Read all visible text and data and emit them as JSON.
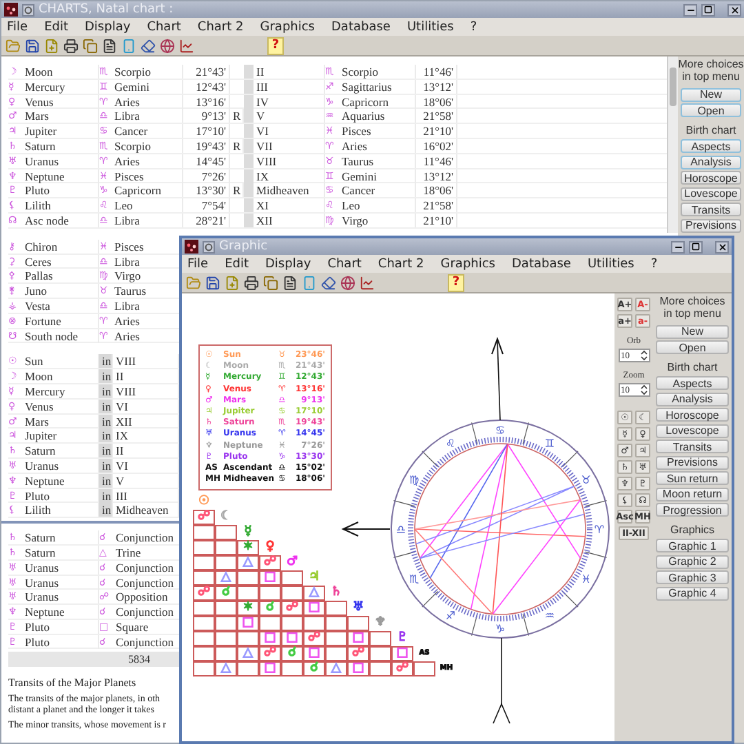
{
  "back_window": {
    "title": "CHARTS, Natal chart :",
    "menu": [
      "File",
      "Edit",
      "Display",
      "Chart",
      "Chart 2",
      "Graphics",
      "Database",
      "Utilities",
      "?"
    ],
    "help": "?",
    "positions": [
      {
        "glyph": "☽",
        "name": "Moon",
        "sign_glyph": "♏",
        "sign": "Scorpio",
        "degree": "21°43'",
        "house": "II",
        "house_sign_glyph": "♏",
        "house_sign": "Scorpio",
        "house_degree": "11°46'"
      },
      {
        "glyph": "☿",
        "name": "Mercury",
        "sign_glyph": "♊",
        "sign": "Gemini",
        "degree": "12°43'",
        "house": "III",
        "house_sign_glyph": "♐",
        "house_sign": "Sagittarius",
        "house_degree": "13°12'"
      },
      {
        "glyph": "♀",
        "name": "Venus",
        "sign_glyph": "♈",
        "sign": "Aries",
        "degree": "13°16'",
        "house": "IV",
        "house_sign_glyph": "♑",
        "house_sign": "Capricorn",
        "house_degree": "18°06'"
      },
      {
        "glyph": "♂",
        "name": "Mars",
        "sign_glyph": "♎",
        "sign": "Libra",
        "degree": "9°13'",
        "retro": "R",
        "house": "V",
        "house_sign_glyph": "♒",
        "house_sign": "Aquarius",
        "house_degree": "21°58'"
      },
      {
        "glyph": "♃",
        "name": "Jupiter",
        "sign_glyph": "♋",
        "sign": "Cancer",
        "degree": "17°10'",
        "house": "VI",
        "house_sign_glyph": "♓",
        "house_sign": "Pisces",
        "house_degree": "21°10'"
      },
      {
        "glyph": "♄",
        "name": "Saturn",
        "sign_glyph": "♏",
        "sign": "Scorpio",
        "degree": "19°43'",
        "retro": "R",
        "house": "VII",
        "house_sign_glyph": "♈",
        "house_sign": "Aries",
        "house_degree": "16°02'"
      },
      {
        "glyph": "♅",
        "name": "Uranus",
        "sign_glyph": "♈",
        "sign": "Aries",
        "degree": "14°45'",
        "house": "VIII",
        "house_sign_glyph": "♉",
        "house_sign": "Taurus",
        "house_degree": "11°46'"
      },
      {
        "glyph": "♆",
        "name": "Neptune",
        "sign_glyph": "♓",
        "sign": "Pisces",
        "degree": "7°26'",
        "house": "IX",
        "house_sign_glyph": "♊",
        "house_sign": "Gemini",
        "house_degree": "13°12'"
      },
      {
        "glyph": "♇",
        "name": "Pluto",
        "sign_glyph": "♑",
        "sign": "Capricorn",
        "degree": "13°30'",
        "retro": "R",
        "house": "Midheaven",
        "house_sign_glyph": "♋",
        "house_sign": "Cancer",
        "house_degree": "18°06'"
      },
      {
        "glyph": "⚸",
        "name": "Lilith",
        "sign_glyph": "♌",
        "sign": "Leo",
        "degree": "7°54'",
        "house": "XI",
        "house_sign_glyph": "♌",
        "house_sign": "Leo",
        "house_degree": "21°58'"
      },
      {
        "glyph": "☊",
        "name": "Asc node",
        "sign_glyph": "♎",
        "sign": "Libra",
        "degree": "28°21'",
        "house": "XII",
        "house_sign_glyph": "♍",
        "house_sign": "Virgo",
        "house_degree": "21°10'"
      }
    ],
    "points": [
      {
        "glyph": "⚷",
        "name": "Chiron",
        "sign_glyph": "♓",
        "sign": "Pisces"
      },
      {
        "glyph": "⚳",
        "name": "Ceres",
        "sign_glyph": "♎",
        "sign": "Libra"
      },
      {
        "glyph": "⚴",
        "name": "Pallas",
        "sign_glyph": "♍",
        "sign": "Virgo"
      },
      {
        "glyph": "⚵",
        "name": "Juno",
        "sign_glyph": "♉",
        "sign": "Taurus"
      },
      {
        "glyph": "⚶",
        "name": "Vesta",
        "sign_glyph": "♎",
        "sign": "Libra"
      },
      {
        "glyph": "⊗",
        "name": "Fortune",
        "sign_glyph": "♈",
        "sign": "Aries"
      },
      {
        "glyph": "☋",
        "name": "South node",
        "sign_glyph": "♈",
        "sign": "Aries"
      }
    ],
    "houses": [
      {
        "glyph": "☉",
        "name": "Sun",
        "prep": "in",
        "house": "VIII"
      },
      {
        "glyph": "☽",
        "name": "Moon",
        "prep": "in",
        "house": "II"
      },
      {
        "glyph": "☿",
        "name": "Mercury",
        "prep": "in",
        "house": "VIII"
      },
      {
        "glyph": "♀",
        "name": "Venus",
        "prep": "in",
        "house": "VI"
      },
      {
        "glyph": "♂",
        "name": "Mars",
        "prep": "in",
        "house": "XII"
      },
      {
        "glyph": "♃",
        "name": "Jupiter",
        "prep": "in",
        "house": "IX"
      },
      {
        "glyph": "♄",
        "name": "Saturn",
        "prep": "in",
        "house": "II"
      },
      {
        "glyph": "♅",
        "name": "Uranus",
        "prep": "in",
        "house": "VI"
      },
      {
        "glyph": "♆",
        "name": "Neptune",
        "prep": "in",
        "house": "V"
      },
      {
        "glyph": "♇",
        "name": "Pluto",
        "prep": "in",
        "house": "III"
      },
      {
        "glyph": "⚸",
        "name": "Lilith",
        "prep": "in",
        "house": "Midheaven"
      }
    ],
    "aspects": [
      {
        "glyph": "♄",
        "name": "Saturn",
        "aspect_glyph": "☌",
        "aspect": "Conjunction"
      },
      {
        "glyph": "♄",
        "name": "Saturn",
        "aspect_glyph": "△",
        "aspect": "Trine"
      },
      {
        "glyph": "♅",
        "name": "Uranus",
        "aspect_glyph": "☌",
        "aspect": "Conjunction"
      },
      {
        "glyph": "♅",
        "name": "Uranus",
        "aspect_glyph": "☌",
        "aspect": "Conjunction"
      },
      {
        "glyph": "♅",
        "name": "Uranus",
        "aspect_glyph": "☍",
        "aspect": "Opposition"
      },
      {
        "glyph": "♆",
        "name": "Neptune",
        "aspect_glyph": "☌",
        "aspect": "Conjunction"
      },
      {
        "glyph": "♇",
        "name": "Pluto",
        "aspect_glyph": "□",
        "aspect": "Square"
      },
      {
        "glyph": "♇",
        "name": "Pluto",
        "aspect_glyph": "☌",
        "aspect": "Conjunction"
      }
    ],
    "total": "5834",
    "article": {
      "title": "Transits of the Major Planets",
      "paragraphs": [
        [
          "The transits of the major planets, in oth",
          "distant a planet and the longer it takes"
        ],
        [
          "The minor transits, whose movement is r"
        ]
      ]
    },
    "panel": {
      "note": "More choices in top menu",
      "buttons": [
        {
          "label": "New",
          "highlighted": true
        },
        {
          "label": "Open",
          "highlighted": true
        }
      ],
      "heading": "Birth chart",
      "chart_buttons": [
        {
          "label": "Aspects",
          "highlighted": true
        },
        {
          "label": "Analysis",
          "highlighted": true
        },
        {
          "label": "Horoscope",
          "highlighted": false
        },
        {
          "label": "Lovescope",
          "highlighted": false
        },
        {
          "label": "Transits",
          "highlighted": false
        },
        {
          "label": "Previsions",
          "highlighted": false
        }
      ]
    }
  },
  "graphic_window": {
    "title": "Graphic",
    "menu": [
      "File",
      "Edit",
      "Display",
      "Chart",
      "Chart 2",
      "Graphics",
      "Database",
      "Utilities",
      "?"
    ],
    "help": "?",
    "legend": [
      {
        "glyph": "☉",
        "name": "Sun",
        "sign_glyph": "♉",
        "degree": "23°46'",
        "color": "#ff9955"
      },
      {
        "glyph": "☾",
        "name": "Moon",
        "sign_glyph": "♏",
        "degree": "21°43'",
        "color": "#aaaaaa"
      },
      {
        "glyph": "☿",
        "name": "Mercury",
        "sign_glyph": "♊",
        "degree": "12°43'",
        "color": "#33aa33"
      },
      {
        "glyph": "♀",
        "name": "Venus",
        "sign_glyph": "♈",
        "degree": "13°16'",
        "color": "#ff3333"
      },
      {
        "glyph": "♂",
        "name": "Mars",
        "sign_glyph": "♎",
        "degree": "9°13'",
        "color": "#ee33ee"
      },
      {
        "glyph": "♃",
        "name": "Jupiter",
        "sign_glyph": "♋",
        "degree": "17°10'",
        "color": "#99cc33"
      },
      {
        "glyph": "♄",
        "name": "Saturn",
        "sign_glyph": "♏",
        "degree": "19°43'",
        "color": "#ee4499"
      },
      {
        "glyph": "♅",
        "name": "Uranus",
        "sign_glyph": "♈",
        "degree": "14°45'",
        "color": "#3333ee"
      },
      {
        "glyph": "♆",
        "name": "Neptune",
        "sign_glyph": "♓",
        "degree": "7°26'",
        "color": "#999999"
      },
      {
        "glyph": "♇",
        "name": "Pluto",
        "sign_glyph": "♑",
        "degree": "13°30'",
        "color": "#9933ee"
      },
      {
        "glyph": "AS",
        "name": "Ascendant",
        "sign_glyph": "♎",
        "degree": "15°02'",
        "color": "#111111"
      },
      {
        "glyph": "MH",
        "name": "Midheaven",
        "sign_glyph": "♋",
        "degree": "18°06'",
        "color": "#111111"
      }
    ],
    "wheel": {
      "signs": [
        "♈",
        "♉",
        "♊",
        "♋",
        "♌",
        "♍",
        "♎",
        "♏",
        "♐",
        "♑",
        "♒",
        "♓"
      ]
    },
    "aspect_grid": {
      "planets": [
        {
          "glyph": "☉",
          "color": "#ff9955"
        },
        {
          "glyph": "☾",
          "color": "#aaaaaa"
        },
        {
          "glyph": "☿",
          "color": "#33aa33"
        },
        {
          "glyph": "♀",
          "color": "#ff3333"
        },
        {
          "glyph": "♂",
          "color": "#ee33ee"
        },
        {
          "glyph": "♃",
          "color": "#99cc33"
        },
        {
          "glyph": "♄",
          "color": "#ee4499"
        },
        {
          "glyph": "♅",
          "color": "#3333ee"
        },
        {
          "glyph": "♆",
          "color": "#999999"
        },
        {
          "glyph": "♇",
          "color": "#9933ee"
        },
        {
          "glyph": "AS",
          "color": "#111111"
        },
        {
          "glyph": "MH",
          "color": "#111111"
        }
      ],
      "rows": [
        [
          {
            "glyph": "☍",
            "color": "#ff5577"
          }
        ],
        [
          null,
          null
        ],
        [
          null,
          null,
          {
            "glyph": "✶",
            "color": "#33aa33"
          }
        ],
        [
          null,
          null,
          {
            "glyph": "△",
            "color": "#9999ff"
          },
          {
            "glyph": "☍",
            "color": "#ff5577"
          }
        ],
        [
          null,
          {
            "glyph": "△",
            "color": "#9999ff"
          },
          null,
          {
            "glyph": "□",
            "color": "#ee55ee"
          },
          null
        ],
        [
          {
            "glyph": "☍",
            "color": "#ff5577"
          },
          {
            "glyph": "☌",
            "color": "#44cc44"
          },
          null,
          null,
          null,
          {
            "glyph": "△",
            "color": "#9999ff"
          }
        ],
        [
          null,
          null,
          {
            "glyph": "✶",
            "color": "#33aa33"
          },
          {
            "glyph": "☌",
            "color": "#44cc44"
          },
          {
            "glyph": "☍",
            "color": "#ff5577"
          },
          {
            "glyph": "□",
            "color": "#ee55ee"
          },
          null
        ],
        [
          null,
          null,
          {
            "glyph": "□",
            "color": "#ee55ee"
          },
          null,
          null,
          null,
          null,
          null
        ],
        [
          null,
          null,
          null,
          {
            "glyph": "□",
            "color": "#ee55ee"
          },
          {
            "glyph": "□",
            "color": "#ee55ee"
          },
          {
            "glyph": "☍",
            "color": "#ff5577"
          },
          null,
          {
            "glyph": "□",
            "color": "#ee55ee"
          },
          null
        ],
        [
          null,
          null,
          {
            "glyph": "△",
            "color": "#9999ff"
          },
          {
            "glyph": "☍",
            "color": "#ff5577"
          },
          {
            "glyph": "☌",
            "color": "#44cc44"
          },
          {
            "glyph": "□",
            "color": "#ee55ee"
          },
          null,
          {
            "glyph": "☍",
            "color": "#ff5577"
          },
          null,
          {
            "glyph": "□",
            "color": "#ee55ee"
          }
        ],
        [
          null,
          {
            "glyph": "△",
            "color": "#9999ff"
          },
          null,
          {
            "glyph": "□",
            "color": "#ee55ee"
          },
          null,
          {
            "glyph": "☌",
            "color": "#44cc44"
          },
          {
            "glyph": "△",
            "color": "#9999ff"
          },
          {
            "glyph": "□",
            "color": "#ee55ee"
          },
          null,
          {
            "glyph": "☍",
            "color": "#ff5577"
          },
          null
        ]
      ]
    },
    "tools": {
      "font_buttons": [
        {
          "label": "A+",
          "color": "#333333"
        },
        {
          "label": "A-",
          "color": "#dd3333"
        },
        {
          "label": "a+",
          "color": "#333333"
        },
        {
          "label": "a-",
          "color": "#dd3333"
        }
      ],
      "orb": {
        "label": "Orb",
        "value": "10"
      },
      "zoom": {
        "label": "Zoom",
        "value": "10"
      },
      "planet_buttons": [
        "☉",
        "☾",
        "☿",
        "♀",
        "♂",
        "♃",
        "♄",
        "♅",
        "♆",
        "♇",
        "⚸",
        "☊",
        "Asc",
        "MH"
      ],
      "houses_button": "II-XII"
    },
    "panel": {
      "note": "More choices in top menu",
      "buttons": [
        "New",
        "Open"
      ],
      "heading": "Birth chart",
      "chart_buttons": [
        "Aspects",
        "Analysis",
        "Horoscope",
        "Lovescope",
        "Transits",
        "Previsions",
        "Sun return",
        "Moon return",
        "Progression"
      ],
      "graphics_heading": "Graphics",
      "graphics_buttons": [
        "Graphic 1",
        "Graphic 2",
        "Graphic 3",
        "Graphic 4"
      ]
    }
  }
}
